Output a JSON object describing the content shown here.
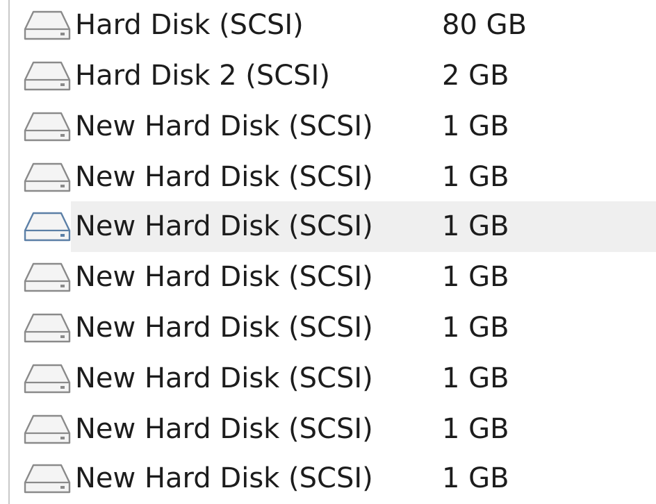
{
  "disk_list": {
    "rows": [
      {
        "name": "Hard Disk (SCSI)",
        "size": "80 GB",
        "icon": "hard-disk-icon",
        "selected": false
      },
      {
        "name": "Hard Disk 2 (SCSI)",
        "size": "2 GB",
        "icon": "hard-disk-icon",
        "selected": false
      },
      {
        "name": "New Hard Disk (SCSI)",
        "size": "1 GB",
        "icon": "hard-disk-icon",
        "selected": false
      },
      {
        "name": "New Hard Disk (SCSI)",
        "size": "1 GB",
        "icon": "hard-disk-icon",
        "selected": false
      },
      {
        "name": "New Hard Disk (SCSI)",
        "size": "1 GB",
        "icon": "hard-disk-icon",
        "selected": true
      },
      {
        "name": "New Hard Disk (SCSI)",
        "size": "1 GB",
        "icon": "hard-disk-icon",
        "selected": false
      },
      {
        "name": "New Hard Disk (SCSI)",
        "size": "1 GB",
        "icon": "hard-disk-icon",
        "selected": false
      },
      {
        "name": "New Hard Disk (SCSI)",
        "size": "1 GB",
        "icon": "hard-disk-icon",
        "selected": false
      },
      {
        "name": "New Hard Disk (SCSI)",
        "size": "1 GB",
        "icon": "hard-disk-icon",
        "selected": false
      },
      {
        "name": "New Hard Disk (SCSI)",
        "size": "1 GB",
        "icon": "hard-disk-icon",
        "selected": false
      }
    ]
  },
  "colors": {
    "icon_stroke": "#8a8a8a",
    "icon_stroke_selected": "#5b7fa6",
    "selection_bg": "#efefef",
    "text": "#1c1c1c"
  }
}
